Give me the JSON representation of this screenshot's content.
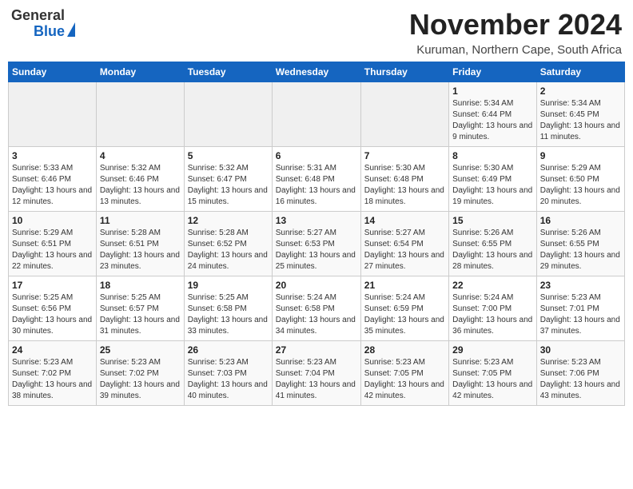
{
  "header": {
    "logo_general": "General",
    "logo_blue": "Blue",
    "month_title": "November 2024",
    "subtitle": "Kuruman, Northern Cape, South Africa"
  },
  "weekdays": [
    "Sunday",
    "Monday",
    "Tuesday",
    "Wednesday",
    "Thursday",
    "Friday",
    "Saturday"
  ],
  "weeks": [
    [
      {
        "day": "",
        "info": ""
      },
      {
        "day": "",
        "info": ""
      },
      {
        "day": "",
        "info": ""
      },
      {
        "day": "",
        "info": ""
      },
      {
        "day": "",
        "info": ""
      },
      {
        "day": "1",
        "info": "Sunrise: 5:34 AM\nSunset: 6:44 PM\nDaylight: 13 hours and 9 minutes."
      },
      {
        "day": "2",
        "info": "Sunrise: 5:34 AM\nSunset: 6:45 PM\nDaylight: 13 hours and 11 minutes."
      }
    ],
    [
      {
        "day": "3",
        "info": "Sunrise: 5:33 AM\nSunset: 6:46 PM\nDaylight: 13 hours and 12 minutes."
      },
      {
        "day": "4",
        "info": "Sunrise: 5:32 AM\nSunset: 6:46 PM\nDaylight: 13 hours and 13 minutes."
      },
      {
        "day": "5",
        "info": "Sunrise: 5:32 AM\nSunset: 6:47 PM\nDaylight: 13 hours and 15 minutes."
      },
      {
        "day": "6",
        "info": "Sunrise: 5:31 AM\nSunset: 6:48 PM\nDaylight: 13 hours and 16 minutes."
      },
      {
        "day": "7",
        "info": "Sunrise: 5:30 AM\nSunset: 6:48 PM\nDaylight: 13 hours and 18 minutes."
      },
      {
        "day": "8",
        "info": "Sunrise: 5:30 AM\nSunset: 6:49 PM\nDaylight: 13 hours and 19 minutes."
      },
      {
        "day": "9",
        "info": "Sunrise: 5:29 AM\nSunset: 6:50 PM\nDaylight: 13 hours and 20 minutes."
      }
    ],
    [
      {
        "day": "10",
        "info": "Sunrise: 5:29 AM\nSunset: 6:51 PM\nDaylight: 13 hours and 22 minutes."
      },
      {
        "day": "11",
        "info": "Sunrise: 5:28 AM\nSunset: 6:51 PM\nDaylight: 13 hours and 23 minutes."
      },
      {
        "day": "12",
        "info": "Sunrise: 5:28 AM\nSunset: 6:52 PM\nDaylight: 13 hours and 24 minutes."
      },
      {
        "day": "13",
        "info": "Sunrise: 5:27 AM\nSunset: 6:53 PM\nDaylight: 13 hours and 25 minutes."
      },
      {
        "day": "14",
        "info": "Sunrise: 5:27 AM\nSunset: 6:54 PM\nDaylight: 13 hours and 27 minutes."
      },
      {
        "day": "15",
        "info": "Sunrise: 5:26 AM\nSunset: 6:55 PM\nDaylight: 13 hours and 28 minutes."
      },
      {
        "day": "16",
        "info": "Sunrise: 5:26 AM\nSunset: 6:55 PM\nDaylight: 13 hours and 29 minutes."
      }
    ],
    [
      {
        "day": "17",
        "info": "Sunrise: 5:25 AM\nSunset: 6:56 PM\nDaylight: 13 hours and 30 minutes."
      },
      {
        "day": "18",
        "info": "Sunrise: 5:25 AM\nSunset: 6:57 PM\nDaylight: 13 hours and 31 minutes."
      },
      {
        "day": "19",
        "info": "Sunrise: 5:25 AM\nSunset: 6:58 PM\nDaylight: 13 hours and 33 minutes."
      },
      {
        "day": "20",
        "info": "Sunrise: 5:24 AM\nSunset: 6:58 PM\nDaylight: 13 hours and 34 minutes."
      },
      {
        "day": "21",
        "info": "Sunrise: 5:24 AM\nSunset: 6:59 PM\nDaylight: 13 hours and 35 minutes."
      },
      {
        "day": "22",
        "info": "Sunrise: 5:24 AM\nSunset: 7:00 PM\nDaylight: 13 hours and 36 minutes."
      },
      {
        "day": "23",
        "info": "Sunrise: 5:23 AM\nSunset: 7:01 PM\nDaylight: 13 hours and 37 minutes."
      }
    ],
    [
      {
        "day": "24",
        "info": "Sunrise: 5:23 AM\nSunset: 7:02 PM\nDaylight: 13 hours and 38 minutes."
      },
      {
        "day": "25",
        "info": "Sunrise: 5:23 AM\nSunset: 7:02 PM\nDaylight: 13 hours and 39 minutes."
      },
      {
        "day": "26",
        "info": "Sunrise: 5:23 AM\nSunset: 7:03 PM\nDaylight: 13 hours and 40 minutes."
      },
      {
        "day": "27",
        "info": "Sunrise: 5:23 AM\nSunset: 7:04 PM\nDaylight: 13 hours and 41 minutes."
      },
      {
        "day": "28",
        "info": "Sunrise: 5:23 AM\nSunset: 7:05 PM\nDaylight: 13 hours and 42 minutes."
      },
      {
        "day": "29",
        "info": "Sunrise: 5:23 AM\nSunset: 7:05 PM\nDaylight: 13 hours and 42 minutes."
      },
      {
        "day": "30",
        "info": "Sunrise: 5:23 AM\nSunset: 7:06 PM\nDaylight: 13 hours and 43 minutes."
      }
    ]
  ]
}
